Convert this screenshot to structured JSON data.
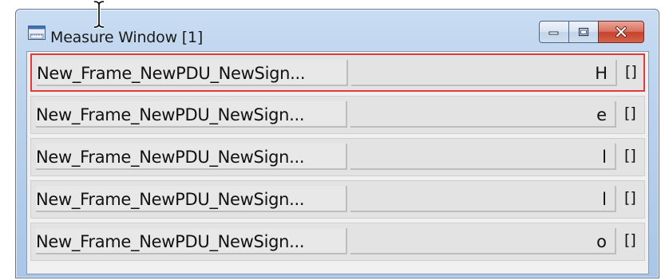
{
  "window": {
    "title": "Measure Window [1]",
    "icon": "ruler-chart-icon"
  },
  "caption_buttons": {
    "minimize": "minimize-icon",
    "maximize": "maximize-icon",
    "close": "close-icon"
  },
  "rows": [
    {
      "name": "New_Frame_NewPDU_NewSign...",
      "value": "H",
      "unit": "[]",
      "selected": true
    },
    {
      "name": "New_Frame_NewPDU_NewSign...",
      "value": "e",
      "unit": "[]",
      "selected": false
    },
    {
      "name": "New_Frame_NewPDU_NewSign...",
      "value": "l",
      "unit": "[]",
      "selected": false
    },
    {
      "name": "New_Frame_NewPDU_NewSign...",
      "value": "l",
      "unit": "[]",
      "selected": false
    },
    {
      "name": "New_Frame_NewPDU_NewSign...",
      "value": "o",
      "unit": "[]",
      "selected": false
    }
  ],
  "colors": {
    "selection_border": "#e23a3a",
    "titlebar": "#b9d1ec",
    "close_button": "#c6432c"
  }
}
